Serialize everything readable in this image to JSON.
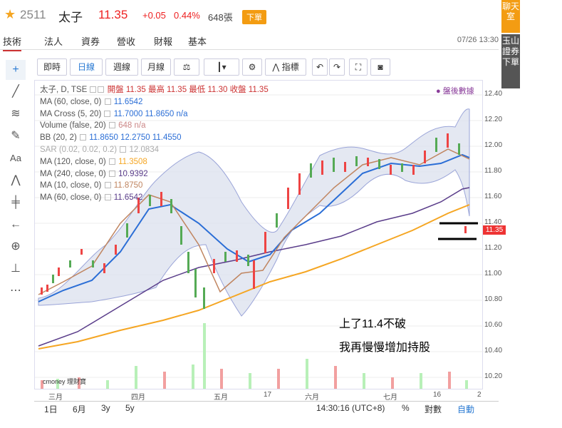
{
  "header": {
    "code": "2511",
    "name": "太子",
    "price": "11.35",
    "change": "+0.05",
    "change_pct": "0.44%",
    "volume": "648張",
    "order_label": "下單"
  },
  "tabs": [
    "技術",
    "法人",
    "資券",
    "營收",
    "財報",
    "基本"
  ],
  "datetime": "07/26 13:30",
  "side": {
    "chat": "聊天室",
    "broker": "玉山證券下單"
  },
  "toolbar": {
    "intraday": "即時",
    "daily": "日線",
    "weekly": "週線",
    "monthly": "月線",
    "indicators": "指標"
  },
  "legend": [
    "太子, D, TSE",
    "MA (60, close, 0)",
    "MA Cross (5, 20)",
    "Volume (false, 20)",
    "BB (20, 2)",
    "SAR (0.02, 0.02, 0.2)",
    "MA (120, close, 0)",
    "MA (240, close, 0)",
    "MA (10, close, 0)",
    "MA (60, close, 0)"
  ],
  "legend_values": {
    "ohlc": "開盤 11.35 最高 11.35 最低 11.30 收盤 11.35",
    "ma60": "11.6542",
    "ma_cross": "11.7000 11.8650 n/a",
    "volume": "648 n/a",
    "bb": "11.8650 12.2750 11.4550",
    "sar": "12.0834",
    "ma120": "11.3508",
    "ma240": "10.9392",
    "ma10": "11.8750",
    "ma60b": "11.6542"
  },
  "posthours": "● 盤後數據",
  "price_tag": "11.35",
  "annotations": {
    "line1": "上了11.4不破",
    "line2": "我再慢慢增加持股"
  },
  "logo": "cmoney 理財寶",
  "bottom": {
    "range1": "1日",
    "range2": "6月",
    "range3": "3y",
    "range4": "5y",
    "time": "14:30:16 (UTC+8)",
    "pct": "%",
    "log": "對數",
    "auto": "自動"
  },
  "chart_data": {
    "type": "candlestick",
    "y_ticks": [
      10.2,
      10.4,
      10.6,
      10.8,
      11.0,
      11.2,
      11.4,
      11.6,
      11.8,
      12.0,
      12.2,
      12.4
    ],
    "x_ticks": [
      "三月",
      "四月",
      "五月",
      "17",
      "六月",
      "七月",
      "16",
      "2"
    ],
    "ylim": [
      10.1,
      12.45
    ]
  }
}
